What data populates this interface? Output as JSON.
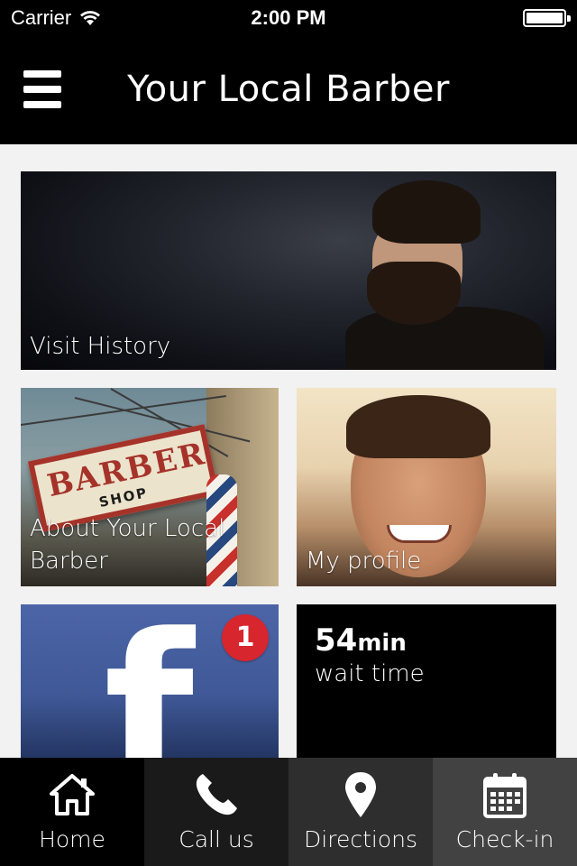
{
  "status_bar": {
    "carrier": "Carrier",
    "time": "2:00 PM",
    "battery_level": 1.0
  },
  "header": {
    "title": "Your Local Barber",
    "menu_icon": "hamburger-menu-icon"
  },
  "tiles": {
    "visit_history": {
      "label": "Visit History"
    },
    "about": {
      "label_line1": "About Your Local",
      "label_line2": "Barber",
      "sign_text": "BARBER",
      "sign_sub": "SHOP"
    },
    "profile": {
      "label": "My profile"
    },
    "facebook": {
      "icon": "facebook-icon",
      "badge_count": "1",
      "glyph": "f"
    },
    "wait_time": {
      "number": "54",
      "unit": "min",
      "label": "wait time"
    }
  },
  "tab_bar": {
    "items": [
      {
        "label": "Home",
        "icon": "home-icon"
      },
      {
        "label": "Call us",
        "icon": "phone-icon"
      },
      {
        "label": "Directions",
        "icon": "map-pin-icon"
      },
      {
        "label": "Check-in",
        "icon": "calendar-icon"
      }
    ]
  },
  "colors": {
    "header_bg": "#000000",
    "page_bg": "#f2f2f2",
    "badge_red": "#d8262e",
    "facebook_blue": "#4c65a7"
  }
}
